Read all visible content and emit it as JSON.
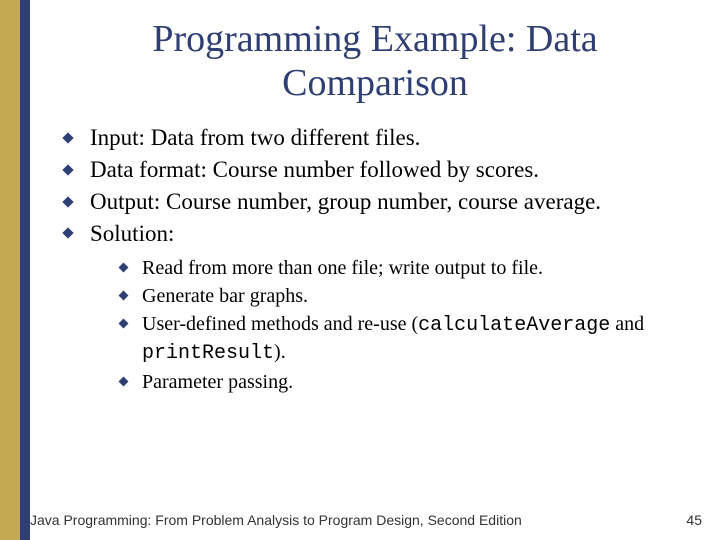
{
  "title": "Programming Example: Data Comparison",
  "bullets": [
    "Input: Data from two different files.",
    "Data format: Course number followed by scores.",
    "Output: Course number, group number, course average.",
    "Solution:"
  ],
  "sub_bullets": [
    "Read from more than one file; write output to file.",
    "Generate bar graphs.",
    "",
    "Parameter passing."
  ],
  "sub3": {
    "prefix": "User-defined methods and re-use (",
    "code1": "calculateAverage",
    "mid": " and ",
    "code2": "printResult",
    "suffix": ")."
  },
  "footer": "Java Programming: From Problem Analysis to Program Design, Second Edition",
  "page_number": "45"
}
